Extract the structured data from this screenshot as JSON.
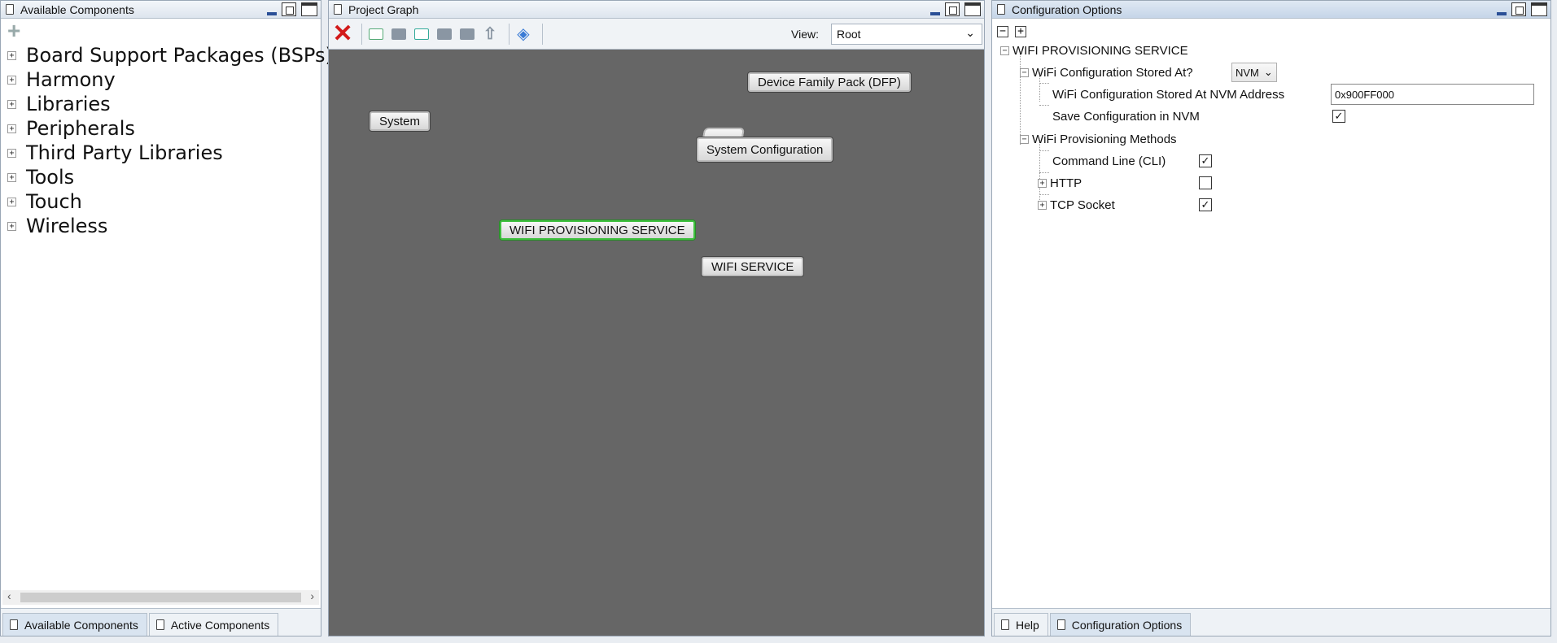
{
  "left_panel": {
    "title": "Available Components",
    "tree": [
      "Board Support Packages (BSPs)",
      "Harmony",
      "Libraries",
      "Peripherals",
      "Third Party Libraries",
      "Tools",
      "Touch",
      "Wireless"
    ],
    "tabs": [
      "Available Components",
      "Active Components"
    ]
  },
  "center_panel": {
    "title": "Project Graph",
    "view_label": "View:",
    "view_value": "Root",
    "nodes": {
      "dfp": "Device Family Pack (DFP)",
      "system": "System",
      "system_config": "System Configuration",
      "wifi_prov": "WIFI PROVISIONING SERVICE",
      "wifi_service": "WIFI SERVICE"
    }
  },
  "right_panel": {
    "title": "Configuration Options",
    "root": "WIFI PROVISIONING SERVICE",
    "stored_at_label": "WiFi Configuration Stored At?",
    "stored_at_value": "NVM",
    "nvm_address_label": "WiFi Configuration Stored At NVM Address",
    "nvm_address_value": "0x900FF000",
    "save_config_label": "Save Configuration in NVM",
    "save_config_checked": true,
    "methods_label": "WiFi Provisioning Methods",
    "cli_label": "Command Line (CLI)",
    "cli_checked": true,
    "http_label": "HTTP",
    "http_checked": false,
    "tcp_label": "TCP Socket",
    "tcp_checked": true,
    "tabs": [
      "Help",
      "Configuration Options"
    ]
  }
}
